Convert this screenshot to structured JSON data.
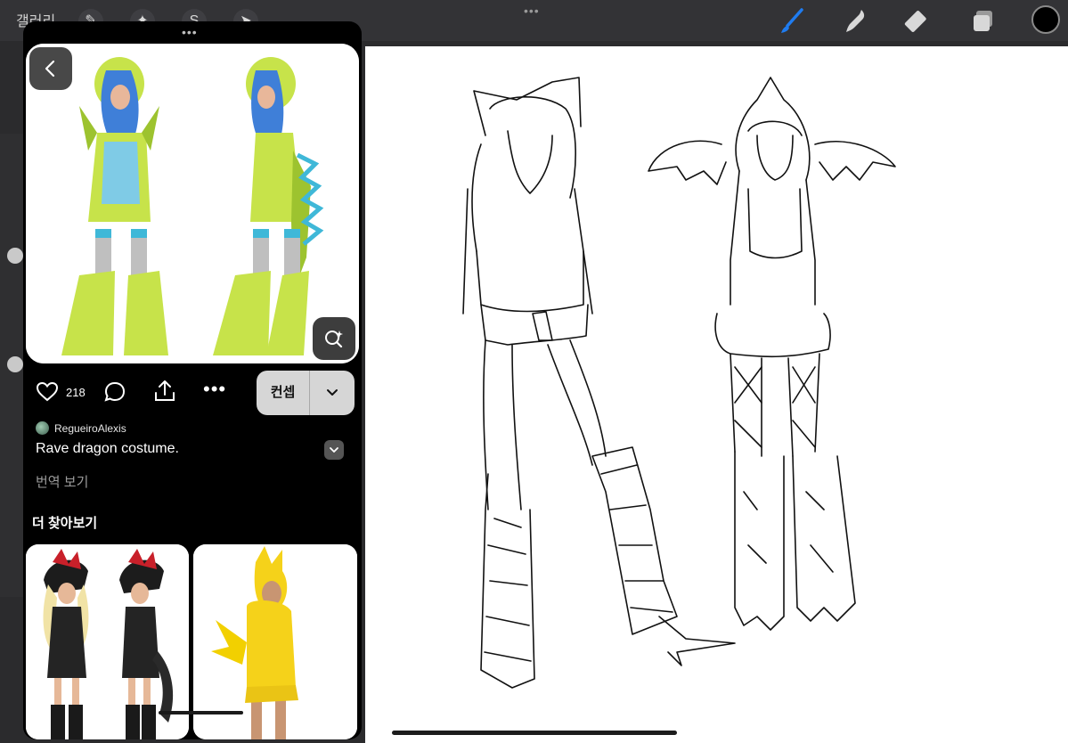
{
  "topbar": {
    "gallery_label": "갤러리",
    "left_tools": [
      "wrench-icon",
      "magic-wand-icon",
      "selection-icon",
      "transform-arrow-icon"
    ],
    "right_tools": [
      "brush-icon",
      "smudge-icon",
      "eraser-icon",
      "layers-icon"
    ],
    "accent_color": "#1f7cf0",
    "current_color": "#000000"
  },
  "pin": {
    "like_count": "218",
    "save_label": "컨셉",
    "author": "RegueiroAlexis",
    "description": "Rave dragon costume.",
    "translate_label": "번역 보기"
  },
  "more": {
    "heading": "더 찾아보기"
  }
}
